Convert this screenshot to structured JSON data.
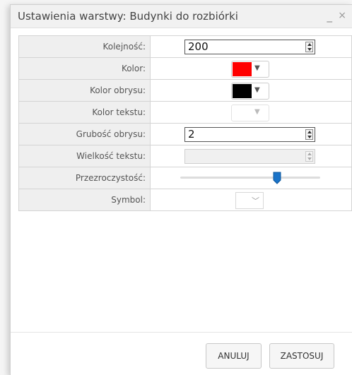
{
  "window": {
    "title": "Ustawienia warstwy: Budynki do rozbiórki",
    "minimize_glyph": "_",
    "close_glyph": "×"
  },
  "rows": {
    "order": {
      "label": "Kolejność:",
      "value": "200"
    },
    "color": {
      "label": "Kolor:",
      "swatch": "#ff0000"
    },
    "outline_color": {
      "label": "Kolor obrysu:",
      "swatch": "#000000"
    },
    "text_color": {
      "label": "Kolor tekstu:",
      "swatch": "#ffffff",
      "disabled": true
    },
    "outline_width": {
      "label": "Grubość obrysu:",
      "value": "2"
    },
    "text_size": {
      "label": "Wielkość tekstu:",
      "value": "",
      "disabled": true
    },
    "transparency": {
      "label": "Przezroczystość:",
      "slider_fraction": 0.69
    },
    "symbol": {
      "label": "Symbol:",
      "value": ""
    }
  },
  "icons": {
    "dropdown": "chevron-down-icon",
    "spinner": "spinner-arrows-icon"
  },
  "colors": {
    "accent": "#1a73c8"
  },
  "buttons": {
    "cancel": "ANULUJ",
    "apply": "ZASTOSUJ"
  }
}
